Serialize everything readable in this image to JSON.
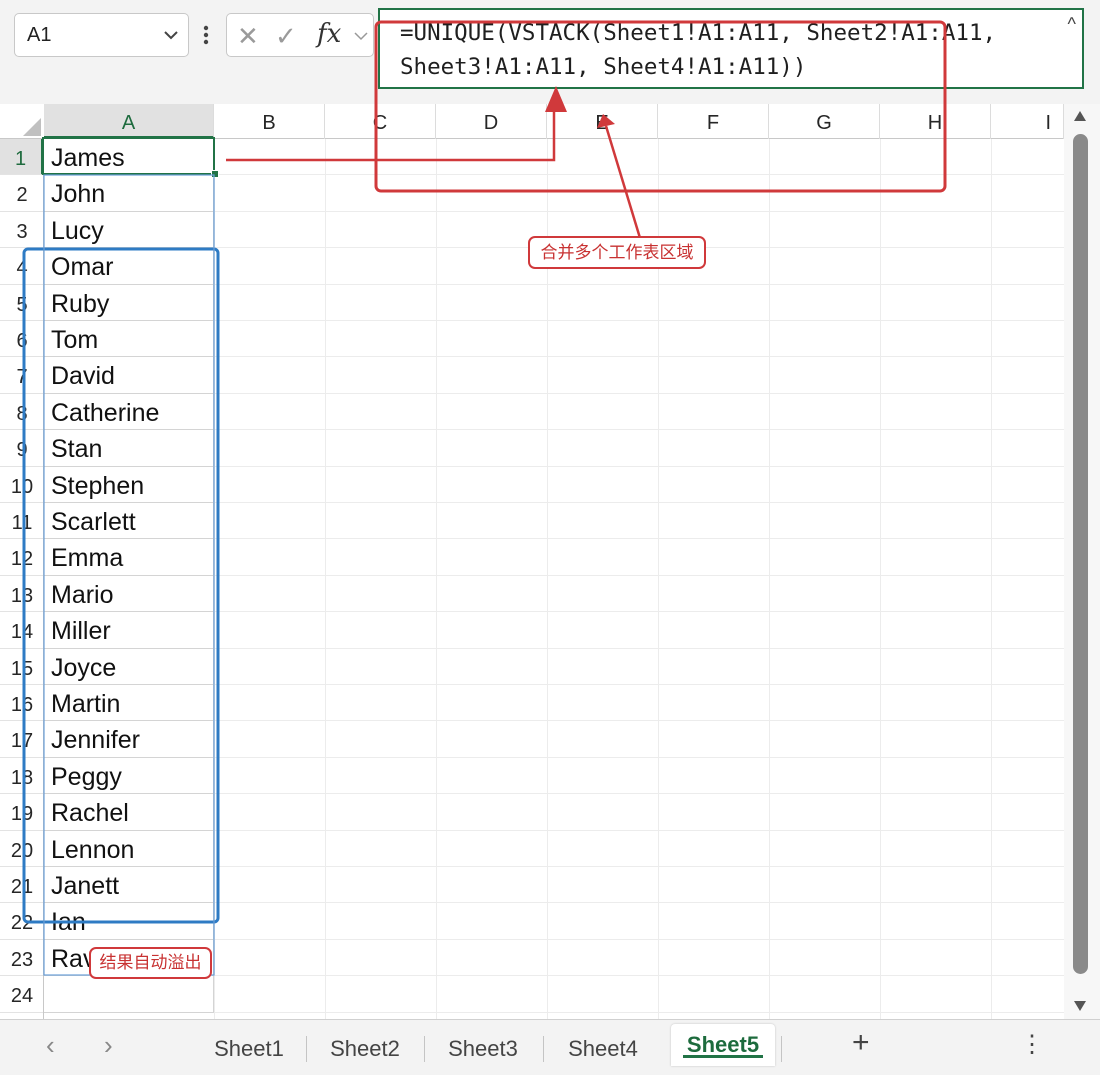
{
  "name_box": {
    "value": "A1"
  },
  "formula": {
    "line1": "=UNIQUE(VSTACK(Sheet1!A1:A11, Sheet2!A1:A11,",
    "line2": "Sheet3!A1:A11, Sheet4!A1:A11))"
  },
  "formula_controls": {
    "cancel": "✕",
    "enter": "✓",
    "fx": "fx",
    "collapse": "^"
  },
  "columns": [
    "A",
    "B",
    "C",
    "D",
    "E",
    "F",
    "G",
    "H",
    "I"
  ],
  "rows": [
    "1",
    "2",
    "3",
    "4",
    "5",
    "6",
    "7",
    "8",
    "9",
    "10",
    "11",
    "12",
    "13",
    "14",
    "15",
    "16",
    "17",
    "18",
    "19",
    "20",
    "21",
    "22",
    "23",
    "24"
  ],
  "cells_A": [
    "James",
    "John",
    "Lucy",
    "Omar",
    "Ruby",
    "Tom",
    "David",
    "Catherine",
    "Stan",
    "Stephen",
    "Scarlett",
    "Emma",
    "Mario",
    "Miller",
    "Joyce",
    "Martin",
    "Jennifer",
    "Peggy",
    "Rachel",
    "Lennon",
    "Janett",
    "Ian",
    "Ravi",
    ""
  ],
  "annotations": {
    "merge": "合并多个工作表区域",
    "spill": "结果自动溢出"
  },
  "sheet_tabs": [
    "Sheet1",
    "Sheet2",
    "Sheet3",
    "Sheet4",
    "Sheet5"
  ],
  "active_sheet": "Sheet5",
  "tab_bar": {
    "prev": "‹",
    "next": "›",
    "add": "+",
    "more": "⋮"
  },
  "colors": {
    "accent_green": "#217346",
    "annotation_red": "#d0393b",
    "annotation_blue": "#2e7bc4"
  }
}
